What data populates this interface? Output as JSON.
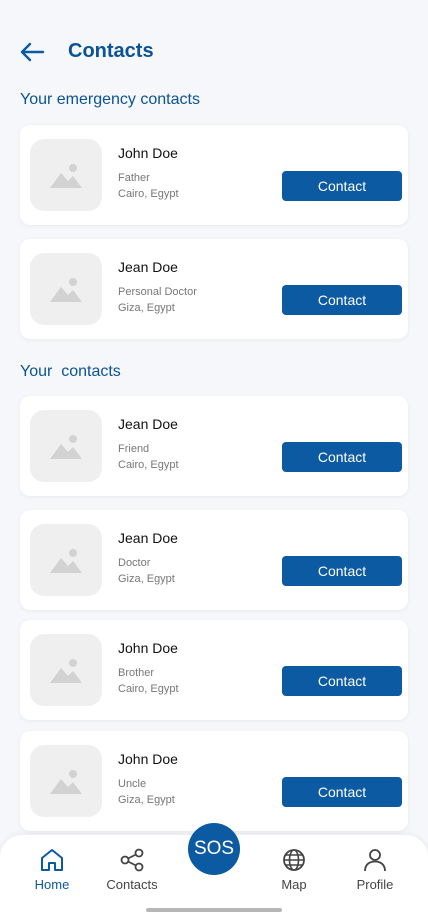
{
  "header": {
    "title": "Contacts"
  },
  "sections": {
    "emergency_title": "Your emergency contacts",
    "contacts_title": "Your  contacts"
  },
  "emergency_contacts": [
    {
      "name": "John Doe",
      "relation": "Father",
      "location": "Cairo, Egypt",
      "button": "Contact"
    },
    {
      "name": "Jean Doe",
      "relation": "Personal Doctor",
      "location": "Giza, Egypt",
      "button": "Contact"
    }
  ],
  "contacts": [
    {
      "name": "Jean Doe",
      "relation": "Friend",
      "location": "Cairo, Egypt",
      "button": "Contact"
    },
    {
      "name": "Jean Doe",
      "relation": "Doctor",
      "location": "Giza, Egypt",
      "button": "Contact"
    },
    {
      "name": "John Doe",
      "relation": "Brother",
      "location": "Cairo, Egypt",
      "button": "Contact"
    },
    {
      "name": "John Doe",
      "relation": "Uncle",
      "location": "Giza, Egypt",
      "button": "Contact"
    }
  ],
  "nav": {
    "home": "Home",
    "contacts": "Contacts",
    "sos": "SOS",
    "map": "Map",
    "profile": "Profile",
    "active": "home"
  },
  "colors": {
    "accent": "#0b5aa2",
    "title": "#0b5394",
    "background": "#f5f7fa"
  }
}
